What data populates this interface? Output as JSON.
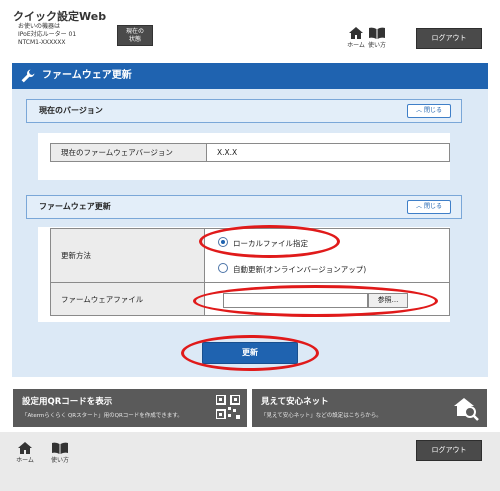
{
  "header": {
    "app_title": "クイック設定Web",
    "device_line1": "お使いの機器は",
    "device_line2": "IPoE対応ルーター 01",
    "device_line3": "NTCM1-XXXXXX",
    "status_line1": "現在の",
    "status_line2": "状態",
    "home_label": "ホーム",
    "guide_label": "使い方",
    "logout_label": "ログアウト"
  },
  "page": {
    "title": "ファームウェア更新"
  },
  "current_version": {
    "heading": "現在のバージョン",
    "close_label": "閉じる",
    "label": "現在のファームウェアバージョン",
    "value": "X.X.X"
  },
  "firmware_update": {
    "heading": "ファームウェア更新",
    "close_label": "閉じる",
    "method_label": "更新方法",
    "options": [
      "ローカルファイル指定",
      "自動更新(オンラインバージョンアップ)"
    ],
    "selected_option": "ローカルファイル指定",
    "file_label": "ファームウェアファイル",
    "file_value": "",
    "browse_label": "参照...",
    "update_label": "更新"
  },
  "banners": {
    "qr_title": "設定用QRコードを表示",
    "qr_desc": "「Atermらくらく QRスタート」用のQRコードを作成できます。",
    "net_title": "見えて安心ネット",
    "net_desc": "「見えて安心ネット」などの設定はこちらから。"
  },
  "footer": {
    "home_label": "ホーム",
    "guide_label": "使い方",
    "logout_label": "ログアウト"
  },
  "colors": {
    "accent_blue": "#1f63b0",
    "panel_bg": "#dce9f6",
    "highlight_ring": "#e01a1a",
    "dark_button": "#4a4a4a"
  }
}
